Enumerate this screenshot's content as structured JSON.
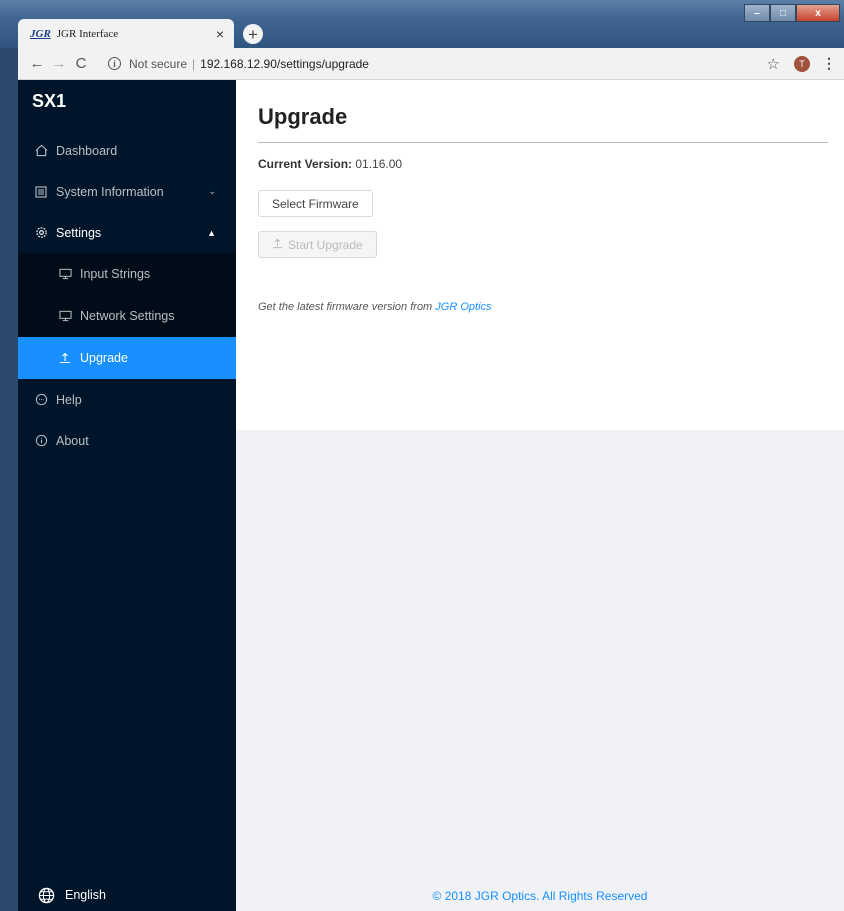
{
  "browser": {
    "tab_logo": "JGR",
    "tab_title": "JGR Interface",
    "not_secure": "Not secure",
    "url": "192.168.12.90/settings/upgrade",
    "avatar_letter": "T"
  },
  "sidebar": {
    "brand": "SX1",
    "items": [
      {
        "label": "Dashboard",
        "icon": "home-icon"
      },
      {
        "label": "System Information",
        "icon": "document-icon"
      },
      {
        "label": "Settings",
        "icon": "gear-icon"
      },
      {
        "label": "Input Strings",
        "icon": "monitor-icon"
      },
      {
        "label": "Network Settings",
        "icon": "monitor-icon"
      },
      {
        "label": "Upgrade",
        "icon": "upload-icon"
      },
      {
        "label": "Help",
        "icon": "message-icon"
      },
      {
        "label": "About",
        "icon": "info-icon"
      }
    ],
    "language": "English"
  },
  "main": {
    "title": "Upgrade",
    "version_label": "Current Version:",
    "version_value": "01.16.00",
    "select_button": "Select Firmware",
    "start_button": "Start Upgrade",
    "hint_text": "Get the latest firmware version from ",
    "hint_link": "JGR Optics",
    "footer": "© 2018 JGR Optics. All Rights Reserved"
  },
  "colors": {
    "sidebar_bg": "#001529",
    "accent": "#1890ff"
  }
}
